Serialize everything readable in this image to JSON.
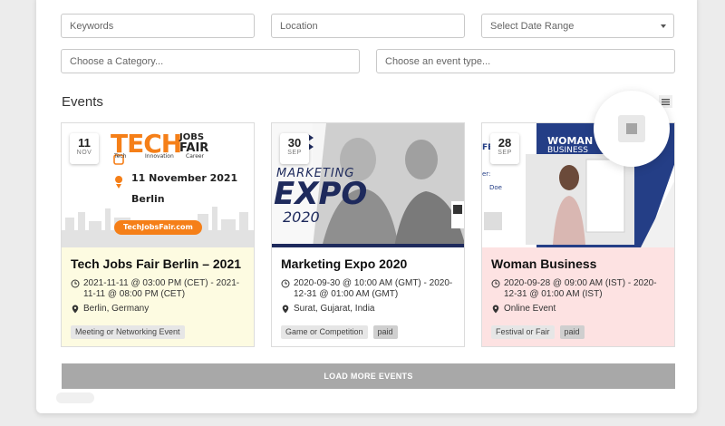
{
  "filters": {
    "keywords_placeholder": "Keywords",
    "location_placeholder": "Location",
    "date_range_label": "Select Date Range",
    "category_placeholder": "Choose a Category...",
    "event_type_placeholder": "Choose an event type..."
  },
  "section": {
    "title": "Events"
  },
  "view_toggle": {
    "grid_icon": "grid-view-icon",
    "list_icon": "list-view-icon"
  },
  "events": [
    {
      "day": "11",
      "month": "NOV",
      "title": "Tech Jobs Fair Berlin – 2021",
      "datetime": "2021-11-11 @ 03:00 PM (CET) - 2021-11-11 @ 08:00 PM (CET)",
      "location": "Berlin, Germany",
      "tags": [
        "Meeting or Networking Event"
      ],
      "body_bg": "#fdfbe1",
      "image": {
        "brand": "TECH",
        "brand_right_1": "JOBS",
        "brand_right_2": "FAIR",
        "sub": [
          "Tech",
          "Innovation",
          "Career"
        ],
        "date_line": "11 November 2021",
        "city_line": "Berlin",
        "url_pill": "TechJobsFair.com",
        "accent": "#f57f18"
      }
    },
    {
      "day": "30",
      "month": "SEP",
      "title": "Marketing Expo 2020",
      "datetime": "2020-09-30 @ 10:00 AM (GMT) - 2020-12-31 @ 01:00 AM (GMT)",
      "location": "Surat, Gujarat, India",
      "tags": [
        "Game or Competition",
        "paid"
      ],
      "body_bg": "#ffffff",
      "image": {
        "line1": "MARKETING",
        "line2": "EXPO",
        "line3": "2020",
        "accent": "#1e2a5c"
      }
    },
    {
      "day": "28",
      "month": "SEP",
      "title": "Woman Business",
      "datetime": "2020-09-28 @ 09:00 AM (IST) - 2020-12-31 @ 01:00 AM (IST)",
      "location": "Online Event",
      "tags": [
        "Festival or Fair",
        "paid"
      ],
      "body_bg": "#fde2e2",
      "image": {
        "line1": "WOMAN",
        "line2": "BUSINESS",
        "side": "BUSINESS",
        "left_fragment": "FE",
        "left_fragment2": "er:",
        "left_fragment3": "Doe",
        "accent": "#243e86"
      }
    }
  ],
  "load_more_label": "LOAD MORE EVENTS",
  "float_button_icon": "stop-icon"
}
